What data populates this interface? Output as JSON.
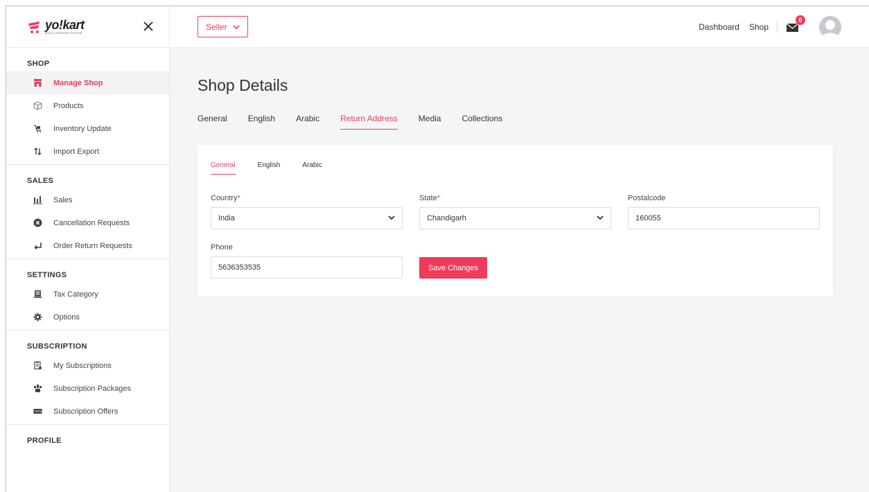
{
  "brand": {
    "name": "yo!kart",
    "tagline": "MULTI-VENDOR SYSTEM"
  },
  "colors": {
    "accent": "#ef3c5b"
  },
  "header": {
    "seller_label": "Seller",
    "links": [
      "Dashboard",
      "Shop"
    ],
    "mail_badge": "0"
  },
  "sidebar": {
    "sections": [
      {
        "title": "SHOP",
        "items": [
          {
            "label": "Manage Shop",
            "icon": "shop-icon",
            "active": true
          },
          {
            "label": "Products",
            "icon": "box-icon"
          },
          {
            "label": "Inventory Update",
            "icon": "inventory-icon"
          },
          {
            "label": "Import Export",
            "icon": "import-export-icon"
          }
        ]
      },
      {
        "title": "SALES",
        "items": [
          {
            "label": "Sales",
            "icon": "bar-chart-icon"
          },
          {
            "label": "Cancellation Requests",
            "icon": "cancel-circle-icon"
          },
          {
            "label": "Order Return Requests",
            "icon": "return-arrow-icon"
          }
        ]
      },
      {
        "title": "SETTINGS",
        "items": [
          {
            "label": "Tax Category",
            "icon": "tax-icon"
          },
          {
            "label": "Options",
            "icon": "gear-icon"
          }
        ]
      },
      {
        "title": "SUBSCRIPTION",
        "items": [
          {
            "label": "My Subscriptions",
            "icon": "subscription-icon"
          },
          {
            "label": "Subscription Packages",
            "icon": "package-icon"
          },
          {
            "label": "Subscription Offers",
            "icon": "offer-icon"
          }
        ]
      },
      {
        "title": "PROFILE",
        "items": []
      }
    ]
  },
  "main": {
    "title": "Shop Details",
    "tabs": [
      "General",
      "English",
      "Arabic",
      "Return Address",
      "Media",
      "Collections"
    ],
    "active_tab": "Return Address",
    "card": {
      "subtabs": [
        "General",
        "English",
        "Arabic"
      ],
      "active_subtab": "General",
      "country": {
        "label": "Country",
        "value": "India"
      },
      "state": {
        "label": "State",
        "value": "Chandigarh"
      },
      "postalcode": {
        "label": "Postalcode",
        "value": "160055"
      },
      "phone": {
        "label": "Phone",
        "value": "5636353535"
      },
      "save_label": "Save Changes"
    }
  }
}
